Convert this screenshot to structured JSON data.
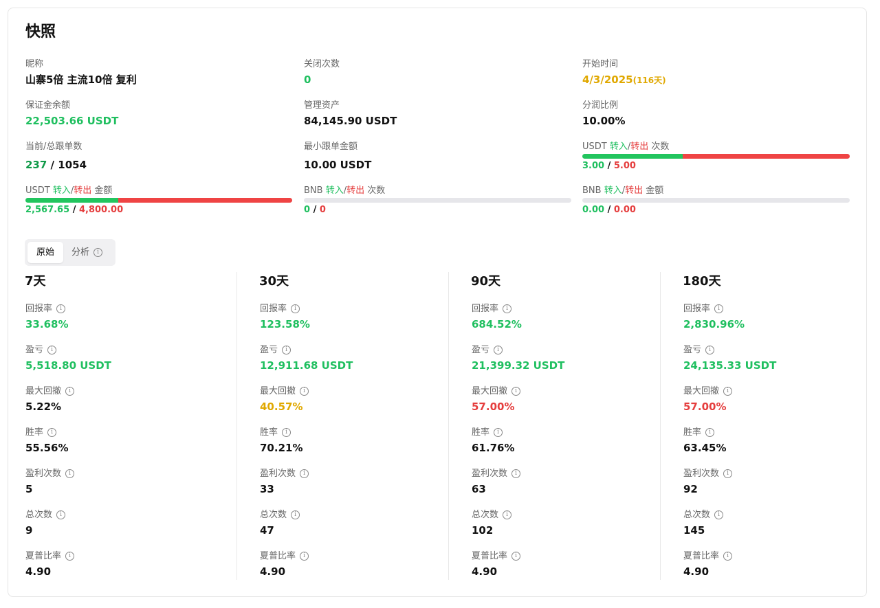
{
  "title": "快照",
  "overview": {
    "nickname": {
      "label": "昵称",
      "value": "山寨5倍 主流10倍 复利"
    },
    "close_count": {
      "label": "关闭次数",
      "value": "0"
    },
    "start_time": {
      "label": "开始时间",
      "value": "4/3/2025",
      "days": "(116天)"
    },
    "margin_balance": {
      "label": "保证金余额",
      "value": "22,503.66 USDT"
    },
    "aum": {
      "label": "管理资产",
      "value": "84,145.90 USDT"
    },
    "profit_share": {
      "label": "分润比例",
      "value": "10.00%"
    },
    "copy_count": {
      "label": "当前/总跟单数",
      "current": "237",
      "sep": "/",
      "total": "1054"
    },
    "min_copy_amount": {
      "label": "最小跟单金额",
      "value": "10.00 USDT"
    },
    "usdt_transfer_count": {
      "label_prefix": "USDT",
      "in_label": "转入",
      "slash": "/",
      "out_label": "转出",
      "label_suffix": "次数",
      "in_value": "3.00",
      "sep": "/",
      "out_value": "5.00",
      "in_ratio": 0.375
    },
    "usdt_transfer_amount": {
      "label_prefix": "USDT",
      "in_label": "转入",
      "slash": "/",
      "out_label": "转出",
      "label_suffix": "金额",
      "in_value": "2,567.65",
      "sep": "/",
      "out_value": "4,800.00",
      "in_ratio": 0.349
    },
    "bnb_transfer_count": {
      "label_prefix": "BNB",
      "in_label": "转入",
      "slash": "/",
      "out_label": "转出",
      "label_suffix": "次数",
      "in_value": "0",
      "sep": "/",
      "out_value": "0",
      "in_ratio": 0
    },
    "bnb_transfer_amount": {
      "label_prefix": "BNB",
      "in_label": "转入",
      "slash": "/",
      "out_label": "转出",
      "label_suffix": "金额",
      "in_value": "0.00",
      "sep": "/",
      "out_value": "0.00",
      "in_ratio": 0
    }
  },
  "tabs": [
    {
      "label": "原始",
      "active": true
    },
    {
      "label": "分析",
      "active": false
    }
  ],
  "periods": [
    {
      "title": "7天",
      "metrics": [
        {
          "label": "回报率",
          "value": "33.68%",
          "color": "green"
        },
        {
          "label": "盈亏",
          "value": "5,518.80 USDT",
          "color": "green"
        },
        {
          "label": "最大回撤",
          "value": "5.22%",
          "color": "black"
        },
        {
          "label": "胜率",
          "value": "55.56%",
          "color": "black"
        },
        {
          "label": "盈利次数",
          "value": "5",
          "color": "black"
        },
        {
          "label": "总次数",
          "value": "9",
          "color": "black"
        },
        {
          "label": "夏普比率",
          "value": "4.90",
          "color": "black"
        }
      ]
    },
    {
      "title": "30天",
      "metrics": [
        {
          "label": "回报率",
          "value": "123.58%",
          "color": "green"
        },
        {
          "label": "盈亏",
          "value": "12,911.68 USDT",
          "color": "green"
        },
        {
          "label": "最大回撤",
          "value": "40.57%",
          "color": "yellow"
        },
        {
          "label": "胜率",
          "value": "70.21%",
          "color": "black"
        },
        {
          "label": "盈利次数",
          "value": "33",
          "color": "black"
        },
        {
          "label": "总次数",
          "value": "47",
          "color": "black"
        },
        {
          "label": "夏普比率",
          "value": "4.90",
          "color": "black"
        }
      ]
    },
    {
      "title": "90天",
      "metrics": [
        {
          "label": "回报率",
          "value": "684.52%",
          "color": "green"
        },
        {
          "label": "盈亏",
          "value": "21,399.32 USDT",
          "color": "green"
        },
        {
          "label": "最大回撤",
          "value": "57.00%",
          "color": "red"
        },
        {
          "label": "胜率",
          "value": "61.76%",
          "color": "black"
        },
        {
          "label": "盈利次数",
          "value": "63",
          "color": "black"
        },
        {
          "label": "总次数",
          "value": "102",
          "color": "black"
        },
        {
          "label": "夏普比率",
          "value": "4.90",
          "color": "black"
        }
      ]
    },
    {
      "title": "180天",
      "metrics": [
        {
          "label": "回报率",
          "value": "2,830.96%",
          "color": "green"
        },
        {
          "label": "盈亏",
          "value": "24,135.33 USDT",
          "color": "green"
        },
        {
          "label": "最大回撤",
          "value": "57.00%",
          "color": "red"
        },
        {
          "label": "胜率",
          "value": "63.45%",
          "color": "black"
        },
        {
          "label": "盈利次数",
          "value": "92",
          "color": "black"
        },
        {
          "label": "总次数",
          "value": "145",
          "color": "black"
        },
        {
          "label": "夏普比率",
          "value": "4.90",
          "color": "black"
        }
      ]
    }
  ],
  "colors": {
    "green": "#1fbf5f",
    "red": "#e53e3e",
    "yellow": "#e0a800",
    "black": "#111111",
    "bar_in": "#22c55e",
    "bar_out": "#ef4444",
    "bar_empty": "#e6e6ea"
  }
}
